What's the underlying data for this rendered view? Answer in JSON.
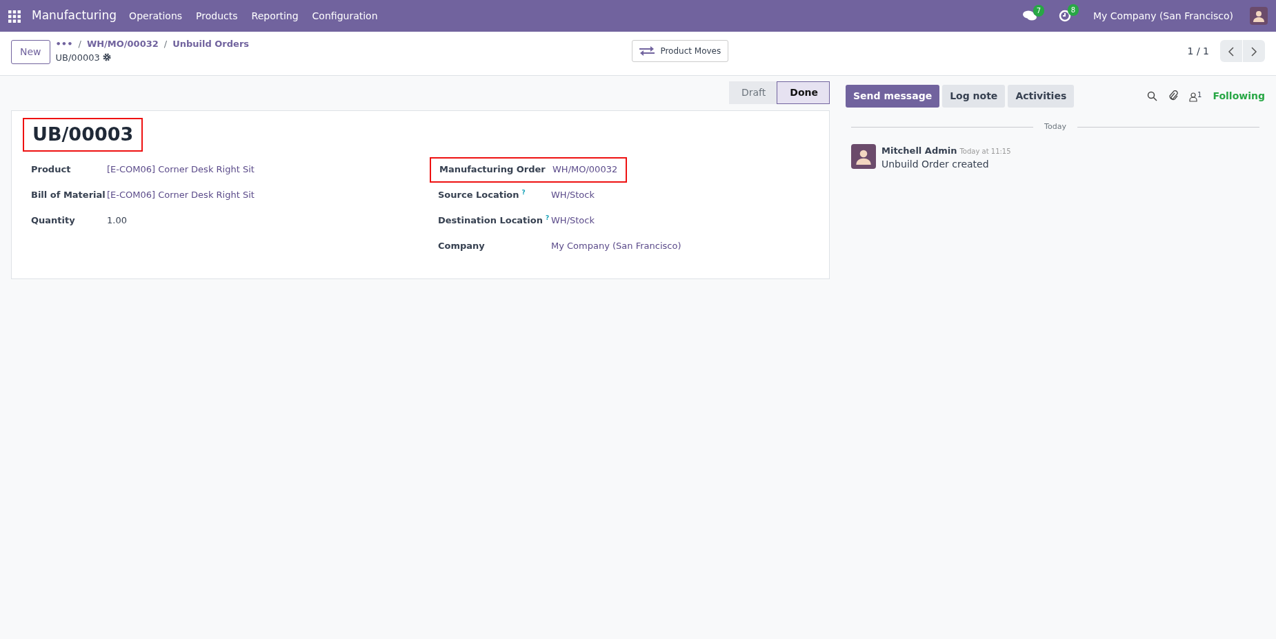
{
  "navbar": {
    "app_name": "Manufacturing",
    "menu": [
      "Operations",
      "Products",
      "Reporting",
      "Configuration"
    ],
    "messages_count": "7",
    "activities_count": "8",
    "company": "My Company (San Francisco)"
  },
  "control_panel": {
    "new_button": "New",
    "breadcrumb_more": "•••",
    "breadcrumbs": [
      {
        "separator": "/",
        "label": "WH/MO/00032"
      },
      {
        "separator": "/",
        "label": "Unbuild Orders"
      }
    ],
    "record_name": "UB/00003",
    "smart_button": "Product Moves",
    "pager": "1 / 1"
  },
  "statusbar": [
    {
      "label": "Draft",
      "selected": false
    },
    {
      "label": "Done",
      "selected": true
    }
  ],
  "form": {
    "title": "UB/00003",
    "title_highlighted": true,
    "left_fields": [
      {
        "label": "Product",
        "value": "[E-COM06] Corner Desk Right Sit",
        "kind": "link",
        "highlighted": false
      },
      {
        "label": "Bill of Material",
        "value": "[E-COM06] Corner Desk Right Sit",
        "kind": "link",
        "highlighted": false
      },
      {
        "label": "Quantity",
        "value": "1.00",
        "kind": "text",
        "highlighted": false
      }
    ],
    "right_fields": [
      {
        "label": "Manufacturing Order",
        "value": "WH/MO/00032",
        "kind": "link",
        "highlighted": true
      },
      {
        "label": "Source Location",
        "help": "?",
        "value": "WH/Stock",
        "kind": "link",
        "highlighted": false
      },
      {
        "label": "Destination Location",
        "help": "?",
        "value": "WH/Stock",
        "kind": "link",
        "highlighted": false
      },
      {
        "label": "Company",
        "value": "My Company (San Francisco)",
        "kind": "link",
        "highlighted": false
      }
    ]
  },
  "chatter": {
    "buttons": [
      {
        "label": "Send message",
        "selected": true
      },
      {
        "label": "Log note",
        "selected": false
      },
      {
        "label": "Activities",
        "selected": false
      }
    ],
    "followers_count": "1",
    "following": "Following",
    "date_separator": "Today",
    "messages": [
      {
        "author": "Mitchell Admin",
        "time": "Today at 11:15",
        "body": "Unbuild Order created"
      }
    ]
  }
}
